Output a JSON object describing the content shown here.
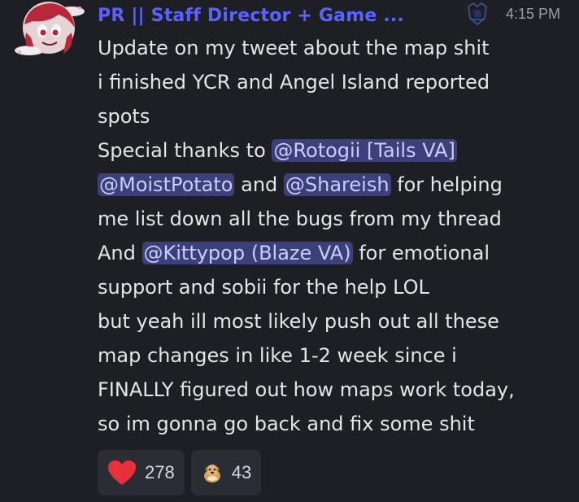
{
  "header": {
    "username": "PR || Staff Director + Game ...",
    "timestamp": "4:15 PM"
  },
  "message": {
    "lines": [
      {
        "parts": [
          {
            "text": "Update on my tweet about the map shit"
          }
        ]
      },
      {
        "parts": [
          {
            "text": "i finished YCR and Angel Island reported"
          }
        ]
      },
      {
        "parts": [
          {
            "text": "spots"
          }
        ]
      },
      {
        "parts": [
          {
            "text": "Special thanks to "
          },
          {
            "text": "@Rotogii [Tails VA]",
            "mention": true
          }
        ]
      },
      {
        "parts": [
          {
            "text": "@MoistPotato",
            "mention": true
          },
          {
            "text": " and "
          },
          {
            "text": "@Shareish",
            "mention": true
          },
          {
            "text": " for helping"
          }
        ]
      },
      {
        "parts": [
          {
            "text": "me list down all the bugs from my thread"
          }
        ]
      },
      {
        "parts": [
          {
            "text": "And "
          },
          {
            "text": "@Kittypop (Blaze VA)",
            "mention": true
          },
          {
            "text": " for emotional"
          }
        ]
      },
      {
        "parts": [
          {
            "text": "support and sobii for the help LOL"
          }
        ]
      },
      {
        "parts": [
          {
            "text": "but yeah ill most likely push out all these"
          }
        ]
      },
      {
        "parts": [
          {
            "text": "map changes in like 1-2 week since i"
          }
        ]
      },
      {
        "parts": [
          {
            "text": "FINALLY figured out how maps work today,"
          }
        ]
      },
      {
        "parts": [
          {
            "text": "so im gonna go back and fix some shit"
          }
        ]
      }
    ]
  },
  "reactions": [
    {
      "icon": "heart-icon",
      "count": "278",
      "color": "#e8303c"
    },
    {
      "icon": "dog-emoji-icon",
      "count": "43",
      "color": "#d9a25a"
    }
  ],
  "colors": {
    "background": "#1e1f24",
    "username": "#5b63ff",
    "mention_bg": "#3c3f7a",
    "mention_text": "#c9cdff"
  }
}
